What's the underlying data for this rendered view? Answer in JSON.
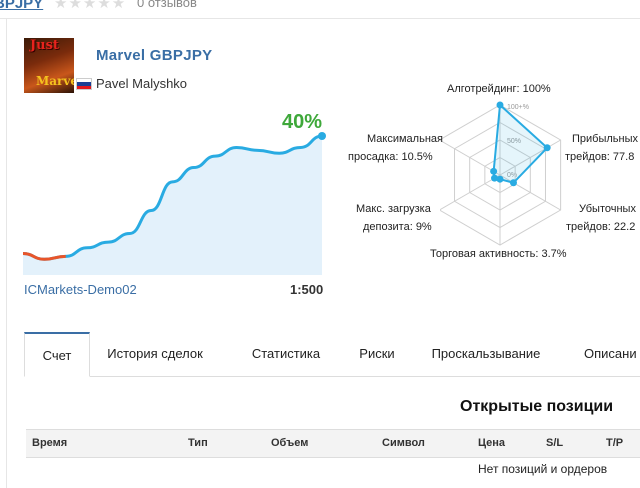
{
  "header": {
    "title_fragment": "BPJPY",
    "stars": "★★★★★",
    "reviews": "0 отзывов"
  },
  "signal": {
    "name": "Marvel GBPJPY",
    "author": "Pavel Malyshko",
    "avatar_text_top": "Just",
    "avatar_text_bottom": "Marvel",
    "growth": "40%",
    "broker": "ICMarkets-Demo02",
    "leverage": "1:500"
  },
  "growth_chart": {
    "type": "line",
    "values": [
      -1,
      -3,
      -2,
      1,
      3,
      6,
      14,
      24,
      29,
      33,
      36,
      35,
      34,
      36,
      40
    ],
    "colors": {
      "positive": "#29abe2",
      "negative": "#e8552a",
      "fill": "#e3f1fb"
    }
  },
  "radar": {
    "labels": {
      "algo": "Алготрейдинг: 100%",
      "drawdown_1": "Максимальная",
      "drawdown_2": "просадка: 10.5%",
      "profit_1": "Прибыльных",
      "profit_2": "трейдов: 77.8",
      "load_1": "Макс. загрузка",
      "load_2": "депозита: 9%",
      "loss_1": "Убыточных",
      "loss_2": "трейдов: 22.2",
      "activity": "Торговая активность: 3.7%"
    },
    "scale": {
      "p100": "100+%",
      "p50": "50%",
      "p0": "0%"
    },
    "values": {
      "algo": 100,
      "profit": 77.8,
      "loss": 22.2,
      "activity": 3.7,
      "load": 9,
      "drawdown": 10.5
    },
    "color": "#29abe2"
  },
  "tabs": [
    {
      "label": "Счет"
    },
    {
      "label": "История сделок"
    },
    {
      "label": "Статистика"
    },
    {
      "label": "Риски"
    },
    {
      "label": "Проскальзывание"
    },
    {
      "label": "Описани"
    }
  ],
  "positions": {
    "title": "Открытые позиции",
    "columns": [
      "Время",
      "Тип",
      "Объем",
      "Символ",
      "Цена",
      "S/L",
      "T/P"
    ],
    "empty": "Нет позиций и ордеров"
  }
}
